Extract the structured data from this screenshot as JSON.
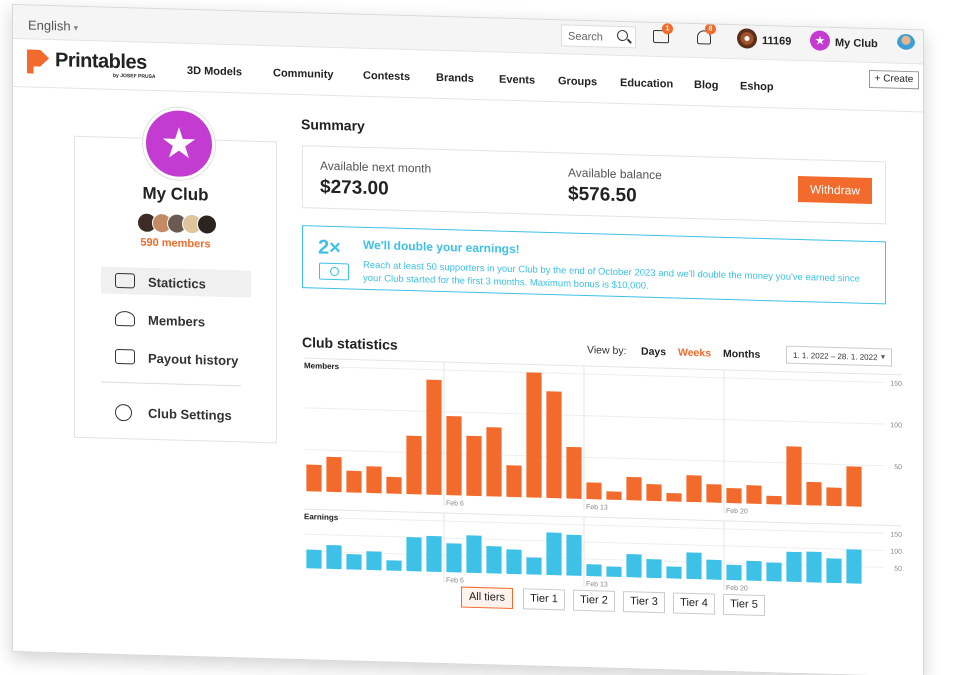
{
  "topbar": {
    "language": "English",
    "search_placeholder": "Search",
    "messages_count": "1",
    "notifications_count": "8",
    "coins": "11169",
    "club_label": "My Club"
  },
  "nav": {
    "brand": "Printables",
    "brand_sub": "by JOSEF PRUSA",
    "items": [
      "3D Models",
      "Community",
      "Contests",
      "Brands",
      "Events",
      "Groups",
      "Education",
      "Blog",
      "Eshop"
    ],
    "create": "+ Create"
  },
  "sidebar": {
    "title": "My Club",
    "members": "590 members",
    "menu": [
      "Statictics",
      "Members",
      "Payout history",
      "Club Settings"
    ]
  },
  "summary": {
    "heading": "Summary",
    "next_month_label": "Available next month",
    "next_month_value": "$273.00",
    "balance_label": "Available balance",
    "balance_value": "$576.50",
    "withdraw": "Withdraw"
  },
  "promo": {
    "multiplier": "2×",
    "title": "We'll double your earnings!",
    "text": "Reach at least 50 supporters in your Club by the end of October 2023 and we'll double the money you've earned since your Club started for the first 3 months. Maximum bonus is $10,000."
  },
  "stats": {
    "heading": "Club statistics",
    "view_by": "View by:",
    "options": [
      "Days",
      "Weeks",
      "Months"
    ],
    "selected": "Weeks",
    "range": "1. 1. 2022 – 28. 1. 2022"
  },
  "tiers": [
    "All tiers",
    "Tier 1",
    "Tier 2",
    "Tier 3",
    "Tier 4",
    "Tier 5"
  ],
  "colors": {
    "accent": "#f36b2c",
    "members_bar": "#f36b2c",
    "earnings_bar": "#3ec1e6",
    "club": "#c43bd1"
  },
  "chart_data": [
    {
      "type": "bar",
      "title": "Members",
      "ylim": [
        0,
        150
      ],
      "yticks": [
        50,
        100,
        150
      ],
      "xticks": [
        "Feb 6",
        "Feb 13",
        "Feb 20"
      ],
      "values": [
        32,
        42,
        26,
        32,
        20,
        70,
        138,
        95,
        72,
        83,
        38,
        150,
        128,
        62,
        20,
        10,
        28,
        20,
        10,
        32,
        22,
        18,
        22,
        10,
        70,
        28,
        22,
        48
      ],
      "color": "#f36b2c"
    },
    {
      "type": "bar",
      "title": "Earnings",
      "ylim": [
        0,
        150
      ],
      "yticks": [
        50,
        100,
        150
      ],
      "xticks": [
        "Feb 6",
        "Feb 13",
        "Feb 20"
      ],
      "values": [
        55,
        70,
        45,
        55,
        30,
        100,
        105,
        85,
        110,
        80,
        72,
        50,
        125,
        120,
        35,
        30,
        68,
        55,
        35,
        78,
        58,
        45,
        58,
        55,
        88,
        90,
        72,
        100
      ],
      "color": "#3ec1e6"
    }
  ]
}
